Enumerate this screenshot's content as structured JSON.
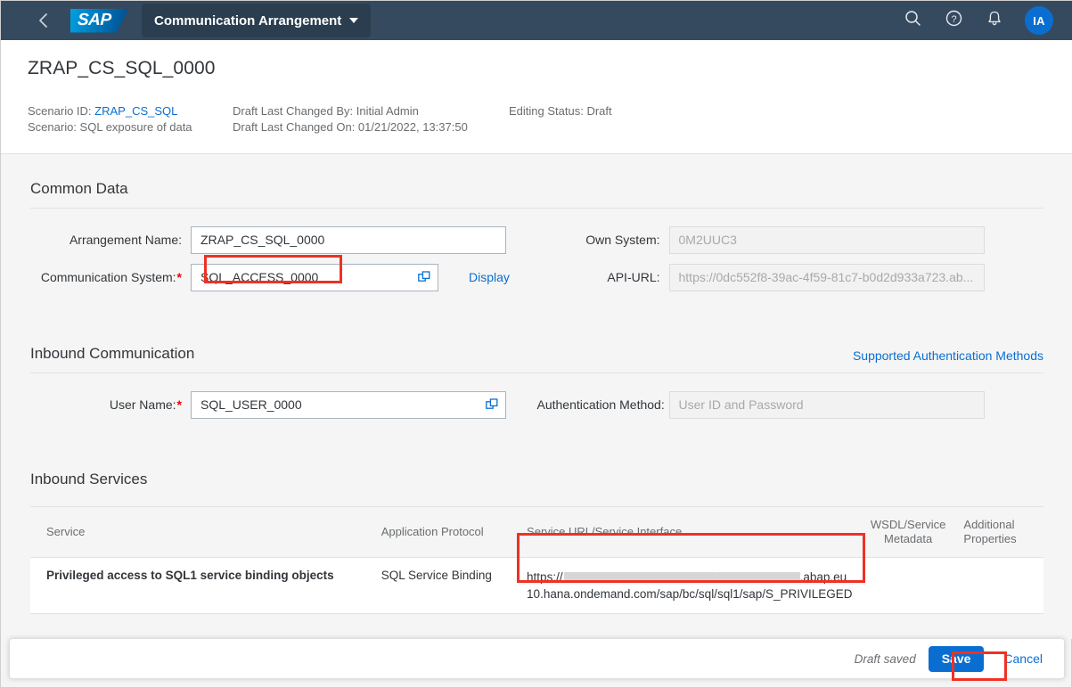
{
  "shell": {
    "back_icon": "chevron-left-icon",
    "logo_text": "SAP",
    "app_title": "Communication Arrangement",
    "search_icon": "search-icon",
    "help_icon": "question-mark-circle-icon",
    "notifications_icon": "bell-icon",
    "avatar_initials": "IA"
  },
  "object_header": {
    "title": "ZRAP_CS_SQL_0000",
    "meta": {
      "scenario_id_label": "Scenario ID:",
      "scenario_id_value": "ZRAP_CS_SQL",
      "scenario_label": "Scenario:",
      "scenario_value": "SQL exposure of data",
      "draft_changed_by": "Draft Last Changed By: Initial Admin",
      "draft_changed_on": "Draft Last Changed On: 01/21/2022, 13:37:50",
      "editing_status": "Editing Status: Draft"
    }
  },
  "common_data": {
    "section_title": "Common Data",
    "arrangement_name_label": "Arrangement Name:",
    "arrangement_name_value": "ZRAP_CS_SQL_0000",
    "communication_system_label": "Communication System:",
    "communication_system_value": "SQL_ACCESS_0000",
    "display_link": "Display",
    "own_system_label": "Own System:",
    "own_system_value": "0M2UUC3",
    "api_url_label": "API-URL:",
    "api_url_value": "https://0dc552f8-39ac-4f59-81c7-b0d2d933a723.ab...",
    "value_help_icon": "value-help-icon"
  },
  "inbound_communication": {
    "section_title": "Inbound Communication",
    "supported_auth_link": "Supported Authentication Methods",
    "user_name_label": "User Name:",
    "user_name_value": "SQL_USER_0000",
    "auth_method_label": "Authentication Method:",
    "auth_method_value": "User ID and Password"
  },
  "inbound_services": {
    "section_title": "Inbound Services",
    "columns": [
      "Service",
      "Application Protocol",
      "Service URL/Service Interface",
      "WSDL/Service Metadata",
      "Additional Properties"
    ],
    "rows": [
      {
        "service": "Privileged access to SQL1 service binding objects",
        "application_protocol": "SQL Service Binding",
        "url_prefix": "https://",
        "url_suffix": ".abap.eu10.hana.ondemand.com/sap/bc/sql/sql1/sap/S_PRIVILEGED",
        "wsdl": "",
        "additional_properties": ""
      }
    ]
  },
  "footer": {
    "draft_status": "Draft saved",
    "save_label": "Save",
    "cancel_label": "Cancel"
  },
  "colors": {
    "shell_background": "#354a5f",
    "accent_blue": "#0a6ed1",
    "annotation_red": "#ee3124",
    "content_background": "#f5f5f5"
  }
}
